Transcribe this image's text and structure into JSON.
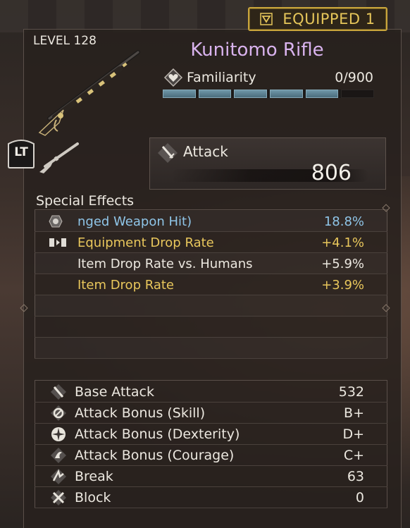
{
  "header": {
    "equipped_label": "EQUIPPED 1",
    "level": "LEVEL 128",
    "lt_label": "LT"
  },
  "weapon": {
    "name": "Kunitomo Rifle",
    "familiarity_label": "Familiarity",
    "familiarity_value": "0/900",
    "familiarity_segments": 6,
    "familiarity_filled_segments": 5,
    "attack_label": "Attack",
    "attack_value": "806"
  },
  "special_effects": {
    "heading": "Special Effects",
    "rows": [
      {
        "icon": "hexagon-emblem-icon",
        "name": "nged Weapon Hit)",
        "value": "18.8%",
        "color": "#8fc5e8"
      },
      {
        "icon": "equipment-set-icon",
        "name": "Equipment Drop Rate",
        "value": "+4.1%",
        "color": "#e9c75c"
      },
      {
        "icon": "",
        "name": "Item Drop Rate vs. Humans",
        "value": "+5.9%",
        "color": "#ece8e0"
      },
      {
        "icon": "",
        "name": "Item Drop Rate",
        "value": "+3.9%",
        "color": "#e9c75c"
      }
    ]
  },
  "stats": {
    "rows": [
      {
        "icon": "base-attack-icon",
        "name": "Base Attack",
        "value": "532"
      },
      {
        "icon": "skill-icon",
        "name": "Attack Bonus (Skill)",
        "value": "B+"
      },
      {
        "icon": "dexterity-icon",
        "name": "Attack Bonus (Dexterity)",
        "value": "D+"
      },
      {
        "icon": "courage-icon",
        "name": "Attack Bonus (Courage)",
        "value": "C+"
      },
      {
        "icon": "break-icon",
        "name": "Break",
        "value": "63"
      },
      {
        "icon": "block-icon",
        "name": "Block",
        "value": "0"
      }
    ]
  },
  "colors": {
    "accent_gold": "#e6c65a",
    "title_purple": "#d9b3ee",
    "familiarity_blue": "#6f97a8"
  }
}
